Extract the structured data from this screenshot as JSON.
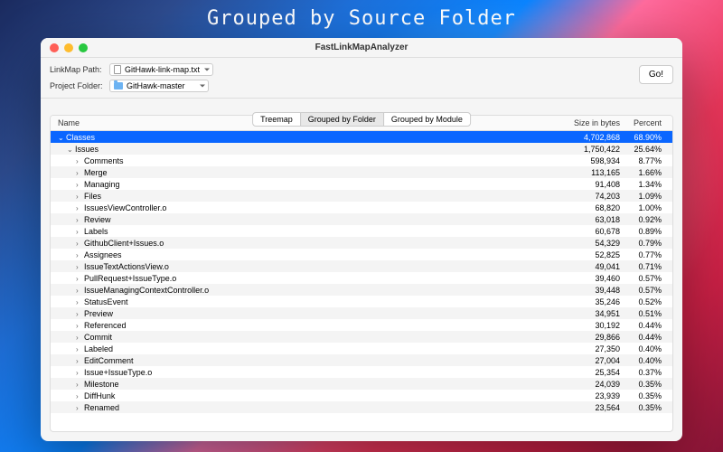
{
  "banner": "Grouped by Source Folder",
  "window_title": "FastLinkMapAnalyzer",
  "toolbar": {
    "linkmap_label": "LinkMap Path:",
    "linkmap_value": "GitHawk-link-map.txt",
    "project_label": "Project Folder:",
    "project_value": "GitHawk-master",
    "go_label": "Go!"
  },
  "tabs": {
    "treemap": "Treemap",
    "by_folder": "Grouped by Folder",
    "by_module": "Grouped by Module"
  },
  "columns": {
    "name": "Name",
    "size": "Size in bytes",
    "percent": "Percent"
  },
  "rows": [
    {
      "name": "Classes",
      "size": "4,702,868",
      "pct": "68.90%",
      "indent": 0,
      "expanded": true,
      "selected": true
    },
    {
      "name": "Issues",
      "size": "1,750,422",
      "pct": "25.64%",
      "indent": 1,
      "expanded": true
    },
    {
      "name": "Comments",
      "size": "598,934",
      "pct": "8.77%",
      "indent": 2
    },
    {
      "name": "Merge",
      "size": "113,165",
      "pct": "1.66%",
      "indent": 2
    },
    {
      "name": "Managing",
      "size": "91,408",
      "pct": "1.34%",
      "indent": 2
    },
    {
      "name": "Files",
      "size": "74,203",
      "pct": "1.09%",
      "indent": 2
    },
    {
      "name": "IssuesViewController.o",
      "size": "68,820",
      "pct": "1.00%",
      "indent": 2
    },
    {
      "name": "Review",
      "size": "63,018",
      "pct": "0.92%",
      "indent": 2
    },
    {
      "name": "Labels",
      "size": "60,678",
      "pct": "0.89%",
      "indent": 2
    },
    {
      "name": "GithubClient+Issues.o",
      "size": "54,329",
      "pct": "0.79%",
      "indent": 2
    },
    {
      "name": "Assignees",
      "size": "52,825",
      "pct": "0.77%",
      "indent": 2
    },
    {
      "name": "IssueTextActionsView.o",
      "size": "49,041",
      "pct": "0.71%",
      "indent": 2
    },
    {
      "name": "PullRequest+IssueType.o",
      "size": "39,460",
      "pct": "0.57%",
      "indent": 2
    },
    {
      "name": "IssueManagingContextController.o",
      "size": "39,448",
      "pct": "0.57%",
      "indent": 2
    },
    {
      "name": "StatusEvent",
      "size": "35,246",
      "pct": "0.52%",
      "indent": 2
    },
    {
      "name": "Preview",
      "size": "34,951",
      "pct": "0.51%",
      "indent": 2
    },
    {
      "name": "Referenced",
      "size": "30,192",
      "pct": "0.44%",
      "indent": 2
    },
    {
      "name": "Commit",
      "size": "29,866",
      "pct": "0.44%",
      "indent": 2
    },
    {
      "name": "Labeled",
      "size": "27,350",
      "pct": "0.40%",
      "indent": 2
    },
    {
      "name": "EditComment",
      "size": "27,004",
      "pct": "0.40%",
      "indent": 2
    },
    {
      "name": "Issue+IssueType.o",
      "size": "25,354",
      "pct": "0.37%",
      "indent": 2
    },
    {
      "name": "Milestone",
      "size": "24,039",
      "pct": "0.35%",
      "indent": 2
    },
    {
      "name": "DiffHunk",
      "size": "23,939",
      "pct": "0.35%",
      "indent": 2
    },
    {
      "name": "Renamed",
      "size": "23,564",
      "pct": "0.35%",
      "indent": 2
    }
  ]
}
